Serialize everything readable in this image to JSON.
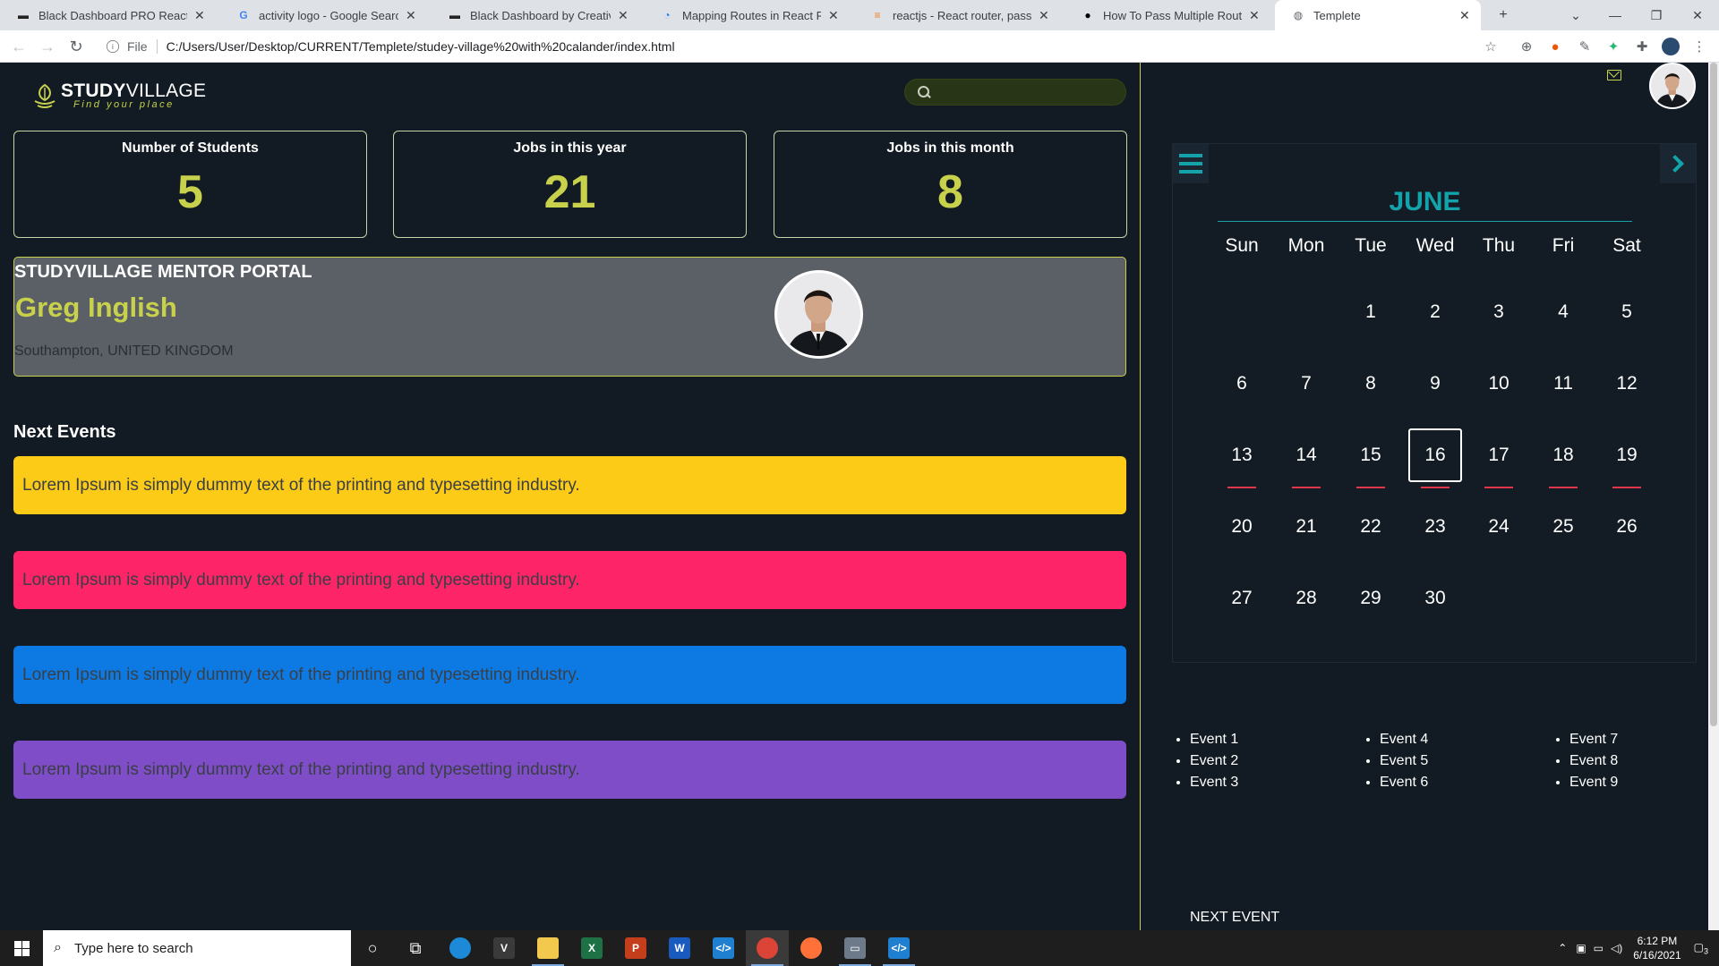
{
  "browser": {
    "tabs": [
      {
        "label": "Black Dashboard PRO React",
        "favicon": "bowtie-icon",
        "active": false
      },
      {
        "label": "activity logo - Google Search",
        "favicon": "google-icon",
        "active": false
      },
      {
        "label": "Black Dashboard by Creative Tim",
        "favicon": "bowtie-icon",
        "active": false
      },
      {
        "label": "Mapping Routes in React Router",
        "favicon": "tutorial-icon",
        "active": false
      },
      {
        "label": "reactjs - React router, pass data",
        "favicon": "stackoverflow-icon",
        "active": false
      },
      {
        "label": "How To Pass Multiple Route Para",
        "favicon": "medium-icon",
        "active": false
      },
      {
        "label": "Templete",
        "favicon": "globe-icon",
        "active": true
      }
    ],
    "url_scheme": "File",
    "url": "C:/Users/User/Desktop/CURRENT/Templete/studey-village%20with%20calander/index.html"
  },
  "app": {
    "logo": {
      "brand_bold": "STUDY",
      "brand_light": "VILLAGE",
      "tagline": "Find your place"
    },
    "search": {
      "placeholder": ""
    },
    "stats": [
      {
        "label": "Number of Students",
        "value": "5"
      },
      {
        "label": "Jobs in this year",
        "value": "21"
      },
      {
        "label": "Jobs in this month",
        "value": "8"
      }
    ],
    "mentor": {
      "heading": "STUDYVILLAGE MENTOR PORTAL",
      "name": "Greg Inglish",
      "location": "Southampton, UNITED KINGDOM"
    },
    "events_title": "Next Events",
    "events": [
      {
        "text": "Lorem Ipsum is simply dummy text of the printing and typesetting industry.",
        "color": "#fccb18"
      },
      {
        "text": "Lorem Ipsum is simply dummy text of the printing and typesetting industry.",
        "color": "#fd2468"
      },
      {
        "text": "Lorem Ipsum is simply dummy text of the printing and typesetting industry.",
        "color": "#0d7ae4"
      },
      {
        "text": "Lorem Ipsum is simply dummy text of the printing and typesetting industry.",
        "color": "#7f4dc8"
      }
    ],
    "calendar": {
      "month": "JUNE",
      "weekdays": [
        "Sun",
        "Mon",
        "Tue",
        "Wed",
        "Thu",
        "Fri",
        "Sat"
      ],
      "first_weekday": 2,
      "days_in_month": 30,
      "today": 16,
      "marked_days": [
        13,
        14,
        15,
        16,
        17,
        18,
        19
      ]
    },
    "event_lists": [
      [
        "Event 1",
        "Event 2",
        "Event 3"
      ],
      [
        "Event 4",
        "Event 5",
        "Event 6"
      ],
      [
        "Event 7",
        "Event 8",
        "Event 9"
      ]
    ],
    "next_event_label": "NEXT EVENT"
  },
  "taskbar": {
    "search_placeholder": "Type here to search",
    "time": "6:12 PM",
    "date": "6/16/2021",
    "notification_count": "3"
  },
  "colors": {
    "accent_lime": "#c8d14c",
    "accent_teal": "#14a3aa",
    "background": "#121b23",
    "mentor_bg": "#5b5f66"
  }
}
